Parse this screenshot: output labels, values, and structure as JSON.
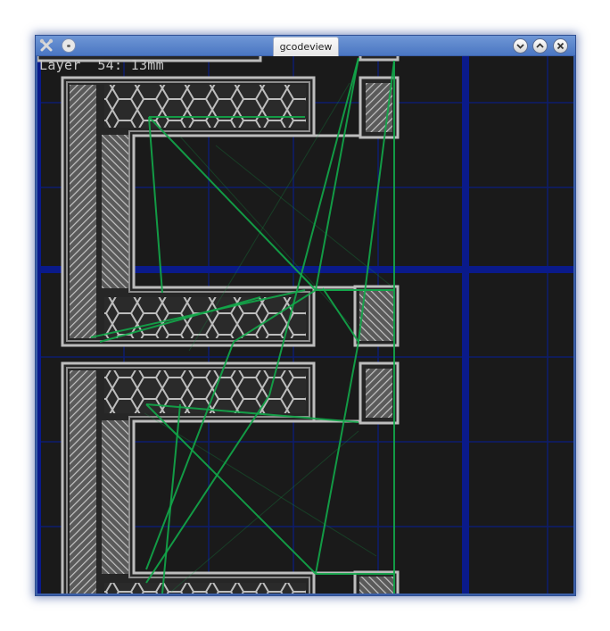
{
  "window": {
    "title": "gcodeview",
    "controls": [
      "minimize-icon",
      "maximize-icon",
      "close-icon"
    ],
    "app_icon": "tools-icon",
    "menu_icon": "window-menu-icon"
  },
  "viewer": {
    "layer_label": "Layer  54: 13mm"
  },
  "colors": {
    "background": "#1a1a1a",
    "grid_minor": "#0c1d6e",
    "grid_major": "#0a1a8a",
    "perimeter": "#bdbdbd",
    "infill": "#9a9a9a",
    "travel": "#12a84a",
    "titlebar": "#4a76c2"
  }
}
